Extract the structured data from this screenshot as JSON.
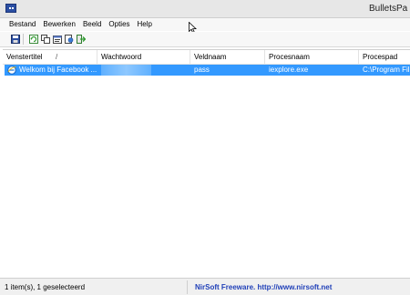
{
  "window": {
    "title": "BulletsPa"
  },
  "menu": {
    "items": [
      "Bestand",
      "Bewerken",
      "Beeld",
      "Opties",
      "Help"
    ]
  },
  "toolbar": {
    "buttons": [
      "save-icon",
      "refresh-icon",
      "copy-icon",
      "properties-icon",
      "html-report-icon",
      "exit-icon"
    ]
  },
  "list": {
    "columns": [
      "Venstertitel",
      "Wachtwoord",
      "Veldnaam",
      "Procesnaam",
      "Procespad"
    ],
    "sort_indicator": "/",
    "rows": [
      {
        "title": "Welkom bij Facebook ...",
        "password": "",
        "field": "pass",
        "process": "iexplore.exe",
        "path": "C:\\Program Fil"
      }
    ]
  },
  "status": {
    "count": "1 item(s), 1 geselecteerd",
    "link": "NirSoft Freeware.  http://www.nirsoft.net"
  },
  "colors": {
    "selection": "#3399ff",
    "link": "#1f3fb8",
    "desktop": "#6b9bd2"
  }
}
